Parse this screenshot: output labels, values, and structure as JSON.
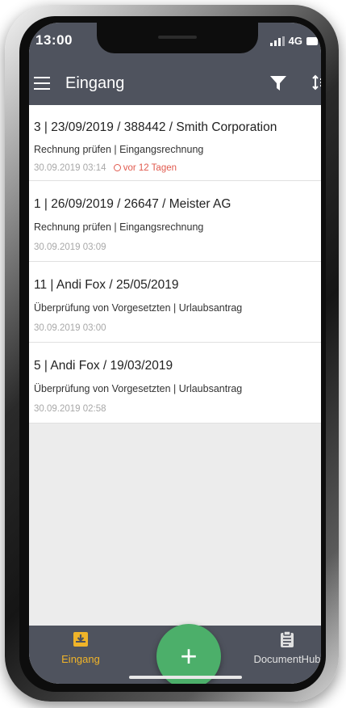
{
  "status": {
    "time": "13:00",
    "network": "4G"
  },
  "appbar": {
    "title": "Eingang"
  },
  "items": [
    {
      "title": "3 | 23/09/2019 / 388442 / Smith Corporation",
      "subtitle": "Rechnung prüfen | Eingangsrechnung",
      "date": "30.09.2019 03:14",
      "overdue": "vor 12 Tagen"
    },
    {
      "title": "1 | 26/09/2019 / 26647 / Meister AG",
      "subtitle": "Rechnung prüfen | Eingangsrechnung",
      "date": "30.09.2019 03:09"
    },
    {
      "title": "11 | Andi Fox / 25/05/2019",
      "subtitle": "Überprüfung von Vorgesetzten | Urlaubsantrag",
      "date": "30.09.2019 03:00"
    },
    {
      "title": "5 | Andi Fox / 19/03/2019",
      "subtitle": "Überprüfung von Vorgesetzten | Urlaubsantrag",
      "date": "30.09.2019 02:58"
    }
  ],
  "nav": {
    "inbox_label": "Eingang",
    "documenthub_label": "DocumentHub"
  },
  "fab": {
    "symbol": "+"
  },
  "colors": {
    "bar": "#4f535e",
    "accent": "#f0b429",
    "fab": "#4caf6a",
    "overdue": "#e15a4e"
  },
  "icons": {
    "menu": "menu-icon",
    "filter": "filter-icon",
    "sort": "sort-icon",
    "inbox": "inbox-icon",
    "clipboard": "clipboard-icon",
    "clock": "clock-icon",
    "add": "plus-icon"
  }
}
